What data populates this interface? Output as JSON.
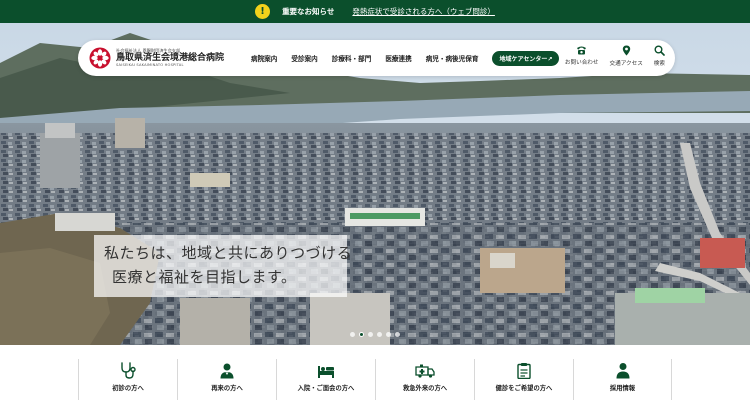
{
  "notice": {
    "icon": "exclamation-icon",
    "title": "重要なお知らせ",
    "link": "発熱症状で受診される方へ（ウェブ問診）"
  },
  "header": {
    "logo": {
      "sub": "社会福祉法人 恩賜財団済生会支部",
      "name": "鳥取県済生会境港総合病院",
      "en": "SAISEIKAI SAKAIMINATO HOSPITAL",
      "icon": "saiseikai-logo-icon"
    },
    "nav": [
      "病院案内",
      "受診案内",
      "診療科・部門",
      "医療連携",
      "病児・病後児保育"
    ],
    "cta": "地域ケアセンター↗",
    "utility": [
      {
        "label": "お問い合わせ",
        "icon": "phone-icon"
      },
      {
        "label": "交通アクセス",
        "icon": "map-pin-icon"
      },
      {
        "label": "検索",
        "icon": "search-icon"
      }
    ]
  },
  "hero": {
    "slogan_line1": "私たちは、地域と共にありつづける",
    "slogan_line2": "医療と福祉を目指します。",
    "slides": 6,
    "active_slide": 1
  },
  "quick_links": [
    {
      "label": "初診の方へ",
      "icon": "stethoscope-icon"
    },
    {
      "label": "再来の方へ",
      "icon": "doctor-icon"
    },
    {
      "label": "入院・ご面会の方へ",
      "icon": "hospital-bed-icon"
    },
    {
      "label": "救急外来の方へ",
      "icon": "ambulance-icon"
    },
    {
      "label": "健診をご希望の方へ",
      "icon": "clipboard-icon"
    },
    {
      "label": "採用情報",
      "icon": "person-icon"
    }
  ],
  "colors": {
    "brand": "#0b4f2c",
    "notice_icon": "#f2d21b",
    "logo_red": "#c8102e"
  }
}
